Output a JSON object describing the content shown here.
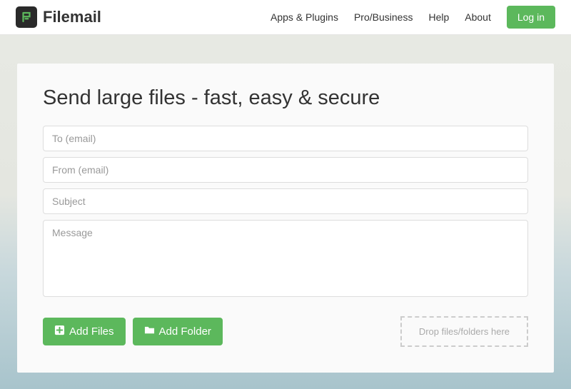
{
  "brand": {
    "name": "Filemail"
  },
  "nav": {
    "apps": "Apps & Plugins",
    "pro": "Pro/Business",
    "help": "Help",
    "about": "About",
    "login": "Log in"
  },
  "main": {
    "title": "Send large files - fast, easy & secure",
    "to_placeholder": "To (email)",
    "from_placeholder": "From (email)",
    "subject_placeholder": "Subject",
    "message_placeholder": "Message",
    "add_files_label": "Add Files",
    "add_folder_label": "Add Folder",
    "drop_zone_label": "Drop files/folders here"
  },
  "colors": {
    "primary": "#5cb85c",
    "text": "#333333",
    "placeholder": "#999999",
    "border": "#dddddd"
  }
}
